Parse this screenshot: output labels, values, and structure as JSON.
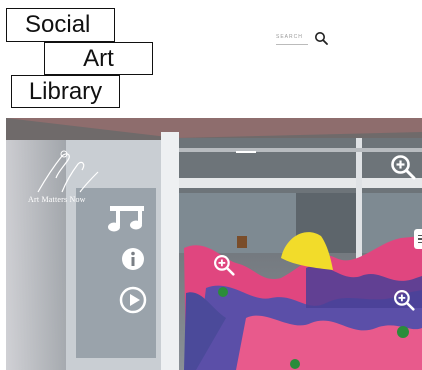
{
  "logo": {
    "line1": "Social",
    "line2": "Art",
    "line3": "Library"
  },
  "search": {
    "placeholder": "SEARCH",
    "icon": "magnifier-icon"
  },
  "viewer": {
    "brand_text": "Art Matters Now",
    "controls": {
      "music": "music-note-icon",
      "info": "info-icon",
      "play": "play-icon"
    },
    "hotspots": [
      "zoom-in-icon",
      "zoom-in-icon",
      "zoom-in-icon"
    ],
    "menu": "menu-icon"
  },
  "colors": {
    "text": "#111111",
    "pink": "#e0467f",
    "purple": "#5b4fa8",
    "yellow": "#f2dc2a",
    "green": "#2b8c3a"
  }
}
